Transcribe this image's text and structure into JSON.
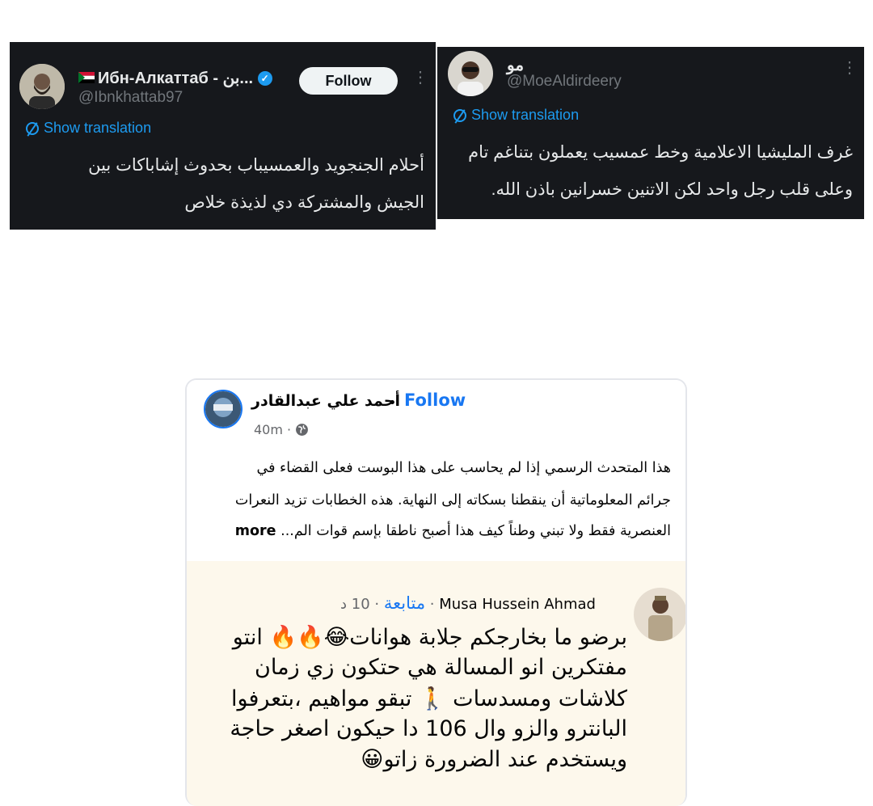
{
  "tweet1": {
    "name": "Ибн-Алкаттаб - بن...",
    "handle": "@Ibnkhattab97",
    "follow_label": "Follow",
    "translate_label": "Show translation",
    "lines": [
      "أحلام الجنجويد والعمسيباب بحدوث إشاباكات بين",
      "الجيش والمشتركة دي لذيذة خلاص"
    ]
  },
  "tweet2": {
    "name": "مو",
    "handle": "@MoeAldirdeery",
    "translate_label": "Show translation",
    "lines": [
      "غرف المليشيا الاعلامية وخط عمسيب يعملون بتناغم تام",
      "وعلى قلب رجل واحد لكن الاتنين خسرانين باذن الله."
    ]
  },
  "fb_post": {
    "author": "أحمد علي عبدالقادر",
    "separator": "•",
    "follow_label": "Follow",
    "time": "40m ·",
    "lines": [
      "هذا المتحدث الرسمي إذا لم يحاسب على هذا البوست فعلى القضاء في",
      "جرائم المعلوماتية أن ينقطنا بسكاته إلى النهاية. هذه الخطابات تزيد النعرات",
      "العنصرية فقط ولا تبني وطناً كيف هذا أصبح ناطقا بإسم قوات الم..."
    ],
    "more_label": "more"
  },
  "fb_comment": {
    "author": "Musa Hussein Ahmad",
    "meta": "· 10 د ·",
    "follow_label": "متابعة",
    "lines": [
      "برضو ما بخارجكم جلابة هوانات😂🔥🔥 انتو",
      "مفتكرين انو المسالة هي حتكون زي زمان",
      "كلاشات ومسدسات 🚶 تبقو مواهيم ،بتعرفوا",
      "البانترو والزو وال 106 دا حيكون اصغر حاجة",
      "ويستخدم عند الضرورة زاتو😀"
    ]
  },
  "colors": {
    "x_bg": "#16181c",
    "x_blue": "#1d9bf0",
    "fb_blue": "#1877f2",
    "comment_bg": "#fdf8ec"
  }
}
